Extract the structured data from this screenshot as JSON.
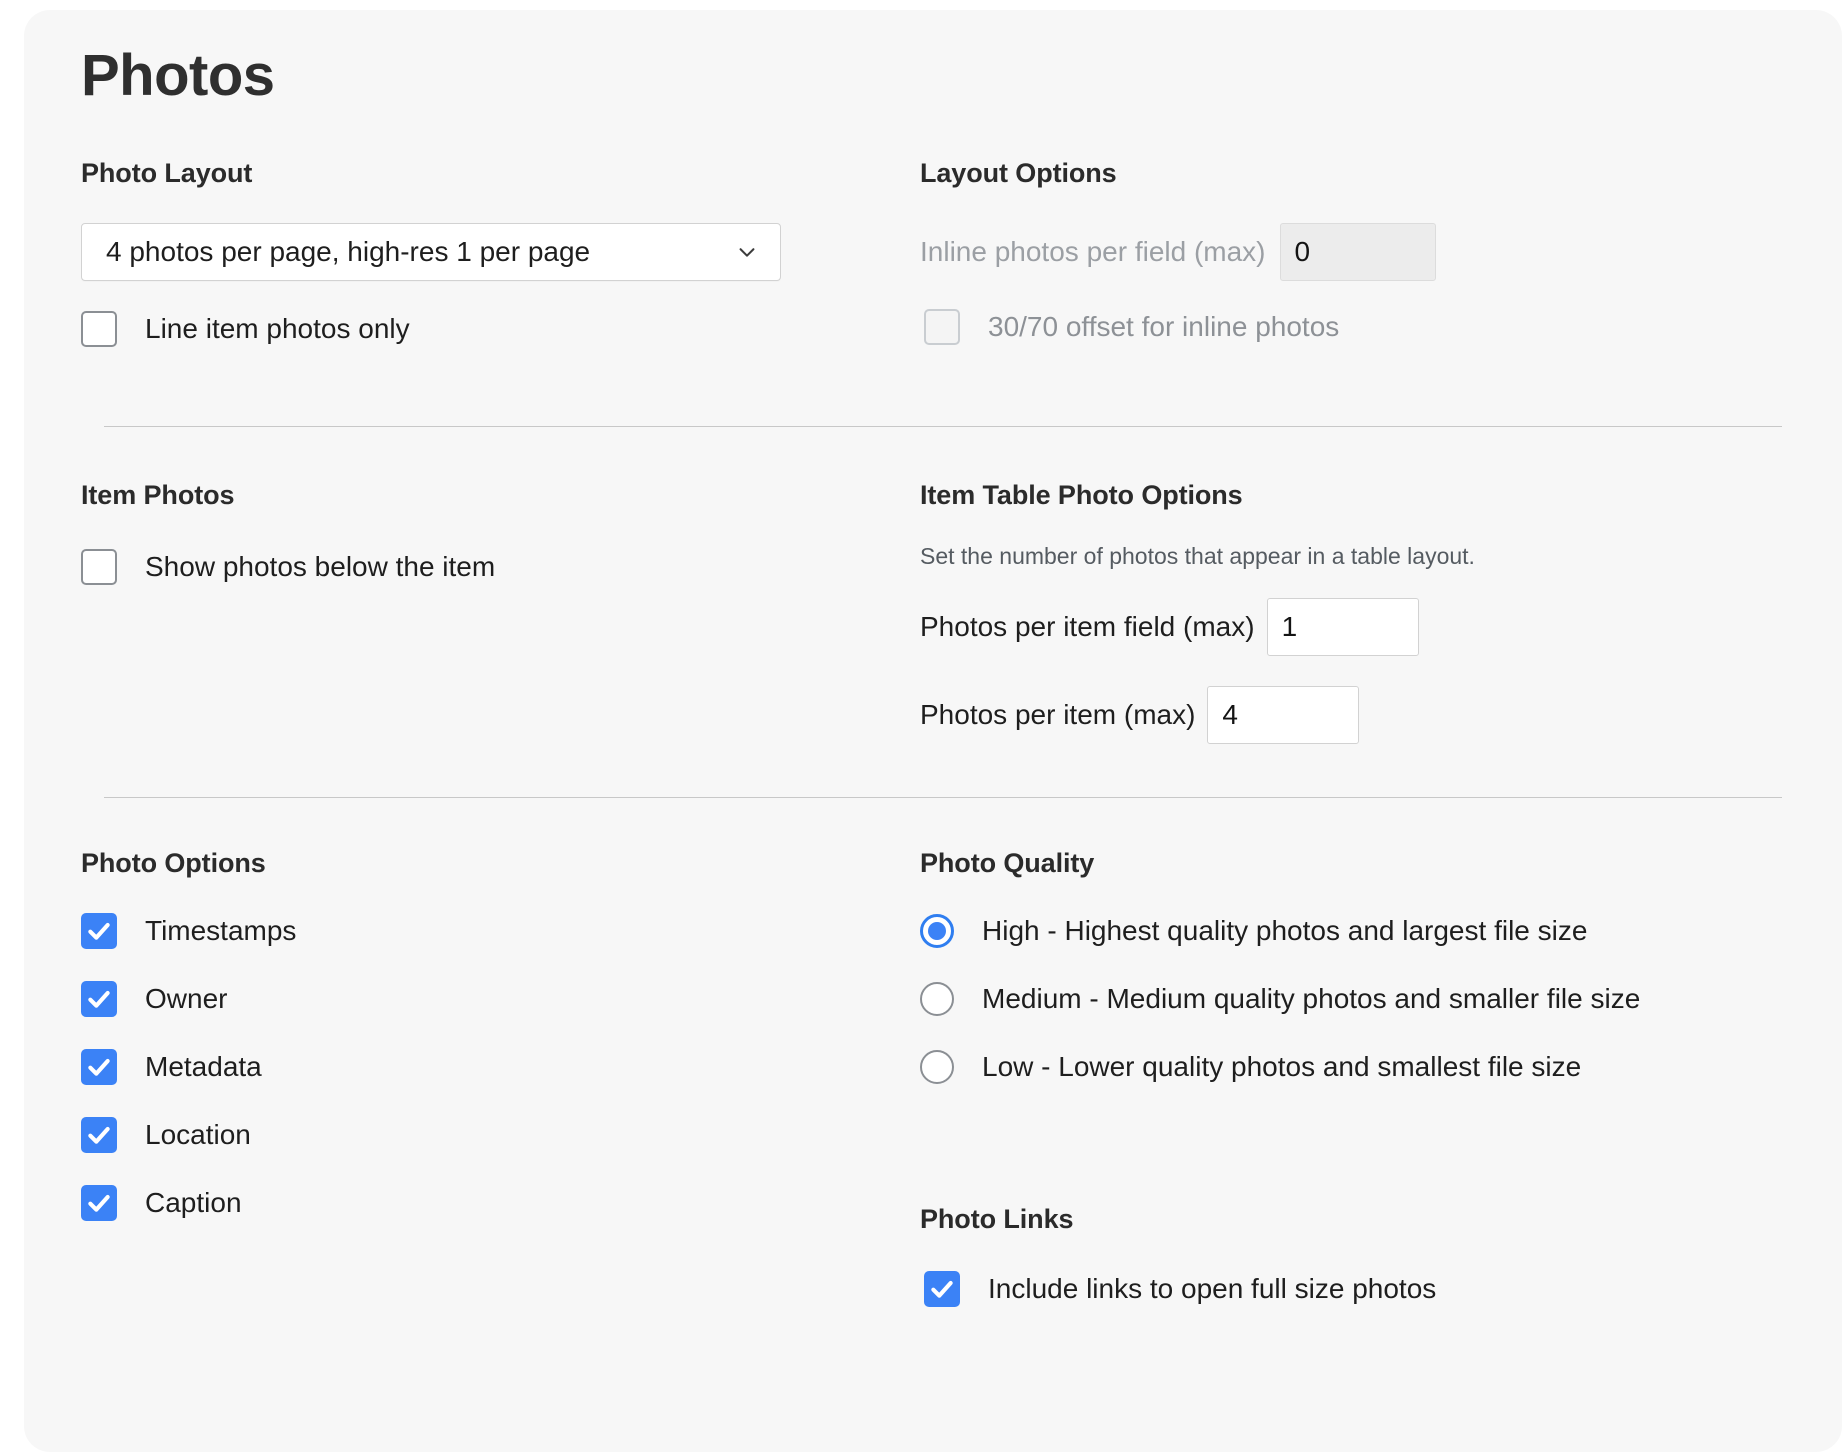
{
  "page": {
    "title": "Photos"
  },
  "photo_layout": {
    "heading": "Photo Layout",
    "select_value": "4 photos per page, high-res 1 per page",
    "select_icon": "chevron-down-icon",
    "line_item_only_label": "Line item photos only",
    "line_item_only_checked": false
  },
  "layout_options": {
    "heading": "Layout Options",
    "inline_per_field_label": "Inline photos per field (max)",
    "inline_per_field_value": "0",
    "inline_per_field_disabled": true,
    "offset_label": "30/70 offset for inline photos",
    "offset_checked": false,
    "offset_disabled": true
  },
  "item_photos": {
    "heading": "Item Photos",
    "show_below_label": "Show photos below the item",
    "show_below_checked": false
  },
  "item_table_photo_options": {
    "heading": "Item Table Photo Options",
    "description": "Set the number of photos that appear in a table layout.",
    "photos_per_item_field_label": "Photos per item field (max)",
    "photos_per_item_field_value": "1",
    "photos_per_item_label": "Photos per item (max)",
    "photos_per_item_value": "4"
  },
  "photo_options": {
    "heading": "Photo Options",
    "items": [
      {
        "label": "Timestamps",
        "checked": true
      },
      {
        "label": "Owner",
        "checked": true
      },
      {
        "label": "Metadata",
        "checked": true
      },
      {
        "label": "Location",
        "checked": true
      },
      {
        "label": "Caption",
        "checked": true
      }
    ]
  },
  "photo_quality": {
    "heading": "Photo Quality",
    "options": [
      {
        "label": "High - Highest quality photos and largest file size",
        "selected": true
      },
      {
        "label": "Medium - Medium quality photos and smaller file size",
        "selected": false
      },
      {
        "label": "Low - Lower quality photos and smallest file size",
        "selected": false
      }
    ]
  },
  "photo_links": {
    "heading": "Photo Links",
    "include_links_label": "Include links to open full size photos",
    "include_links_checked": true
  },
  "colors": {
    "accent": "#3b82f6",
    "card_background": "#f7f7f7",
    "text": "#1e1e1e",
    "muted_text": "#8d9196",
    "divider": "#c8c8c8"
  }
}
